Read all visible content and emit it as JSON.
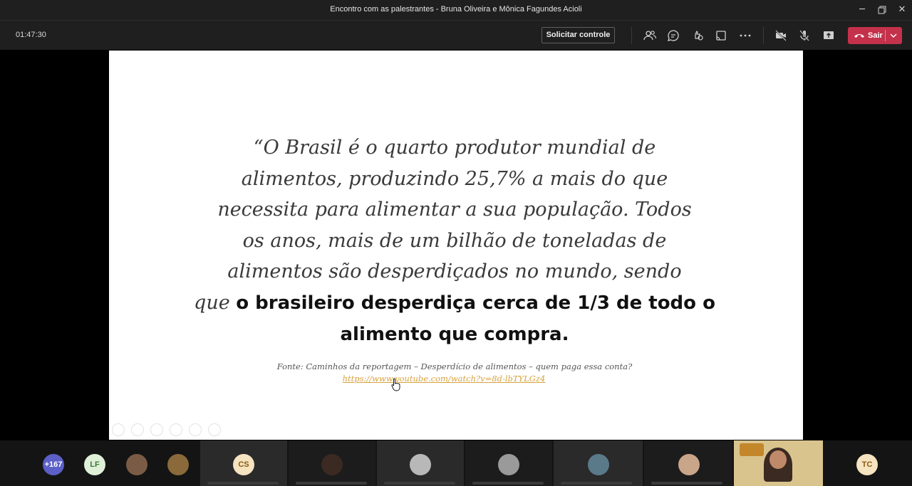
{
  "window": {
    "title": "Encontro com as palestrantes - Bruna Oliveira e Mônica Fagundes Acioli"
  },
  "toolbar": {
    "timer": "01:47:30",
    "request_control_label": "Solicitar controle",
    "leave_label": "Sair",
    "icons": [
      "participants-icon",
      "chat-icon",
      "reactions-icon",
      "share-tray-icon",
      "more-icon",
      "camera-off-icon",
      "mic-off-icon",
      "share-icon"
    ]
  },
  "slide": {
    "line1": "“O Brasil é o quarto produtor mundial de",
    "line2": "alimentos, produzindo 25,7% a mais do que",
    "line3": "necessita para alimentar a sua população. Todos",
    "line4": "os anos, mais de um bilhão de toneladas de",
    "line5": "alimentos são desperdiçados no mundo, sendo",
    "line6_normal": "que ",
    "line6_bold": "o brasileiro desperdiça cerca de 1/3 de todo o",
    "line7_bold": "alimento que compra.",
    "source": "Fonte: Caminhos da reportagem – Desperdício de alimentos – quem paga essa conta?",
    "link": "https://www.youtube.com/watch?v=8d-lbTYLGz4"
  },
  "participants": {
    "overflow_count": "+167",
    "tiles": [
      {
        "initials": "LF",
        "color": "#dff0d8",
        "text_color": "#3a7a3a"
      },
      {
        "initials": "CS",
        "color": "#f6e3c0",
        "text_color": "#8a5a12"
      },
      {
        "initials": "TC",
        "color": "#f6e3c0",
        "text_color": "#8a5a12"
      }
    ]
  },
  "colors": {
    "leave": "#c4314b",
    "overflow_badge": "#5b5fc7",
    "link": "#d6a23f"
  }
}
